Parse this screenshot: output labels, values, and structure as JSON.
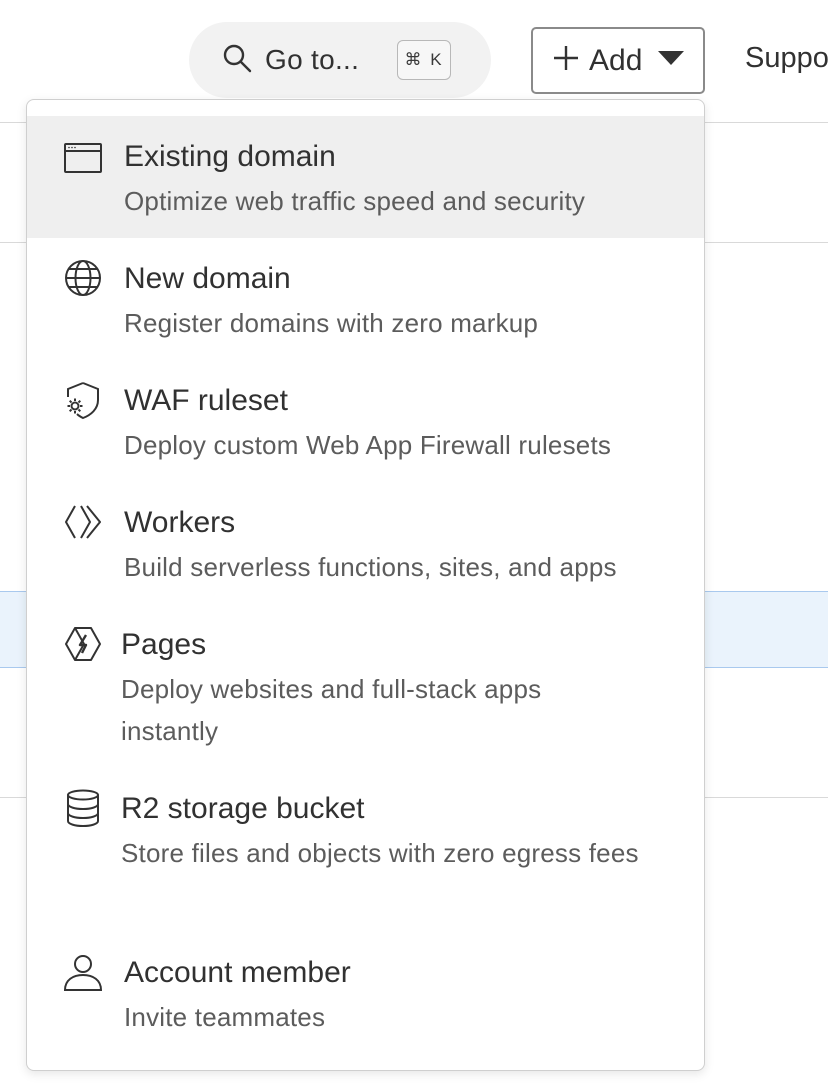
{
  "topbar": {
    "goto_label": "Go to...",
    "goto_shortcut": "⌘ K",
    "add_label": "Add",
    "support_label": "Support"
  },
  "menu": {
    "items": [
      {
        "title": "Existing domain",
        "description": "Optimize web traffic speed and security",
        "icon": "browser-window-icon",
        "active": true
      },
      {
        "title": "New domain",
        "description": "Register domains with zero markup",
        "icon": "globe-icon",
        "active": false
      },
      {
        "title": "WAF ruleset",
        "description": "Deploy custom Web App Firewall rulesets",
        "icon": "shield-gear-icon",
        "active": false
      },
      {
        "title": "Workers",
        "description": "Build serverless functions, sites, and apps",
        "icon": "workers-icon",
        "active": false
      },
      {
        "title": "Pages",
        "description": "Deploy websites and full-stack apps instantly",
        "icon": "pages-lightning-icon",
        "active": false
      },
      {
        "title": "R2 storage bucket",
        "description": "Store files and objects with zero egress fees",
        "icon": "database-icon",
        "active": false
      },
      {
        "title": "Account member",
        "description": "Invite teammates",
        "icon": "person-icon",
        "active": false
      }
    ]
  },
  "colors": {
    "active_item_bg": "#efefef",
    "row_highlight": "#eaf3fc",
    "text_primary": "#313131",
    "text_secondary": "#5c5c5c"
  }
}
